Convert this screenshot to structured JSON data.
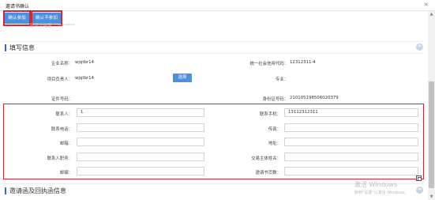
{
  "window": {
    "title": "邀请书确认",
    "close": "×"
  },
  "toolbar": {
    "confirm_join": "确认参加",
    "confirm_decline": "确认不参加"
  },
  "faint_row": "联系人电话：   ********",
  "section_fill": {
    "title": "填写信息"
  },
  "info": {
    "enterprise_name_label": "企业名称：",
    "enterprise_name_value": "wjqtbr14",
    "credit_code_label": "统一社会信用代码：",
    "credit_code_value": "12312311-4",
    "project_leader_label": "项目负责人：",
    "project_leader_value": "wjqtbr14",
    "select_button": "选择",
    "major_label": "专业：",
    "major_value": "",
    "cert_no_label": "证件号码：",
    "cert_no_value": "",
    "id_no_label": "身份证号码：",
    "id_no_value": "210105198506020379"
  },
  "form": {
    "contact_label": "联系人：",
    "contact_value": "1",
    "contact_mobile_label": "联系手机：",
    "contact_mobile_value": "13112312311",
    "contact_phone_label": "联系电话：",
    "contact_phone_value": "",
    "fax_label": "传真：",
    "fax_value": "",
    "email_label": "邮箱：",
    "email_value": "",
    "address_label": "地址：",
    "address_value": "",
    "contact_position_label": "联系人职务：",
    "contact_position_value": "",
    "trading_entity_label": "交易主体姓名：",
    "trading_entity_value": "",
    "postcode_label": "邮编：",
    "postcode_value": "",
    "invitation_pages_label": "邀请书页数：",
    "invitation_pages_value": ""
  },
  "section_invite": {
    "title": "邀请函及回执函信息"
  },
  "watermark": {
    "line1": "激活 Windows",
    "line2": "转到\"设置\"以激活 Windows。"
  },
  "colors": {
    "accent": "#4a8fe0",
    "highlight_border": "#d9232e",
    "section_bar": "#2f6fcb"
  }
}
